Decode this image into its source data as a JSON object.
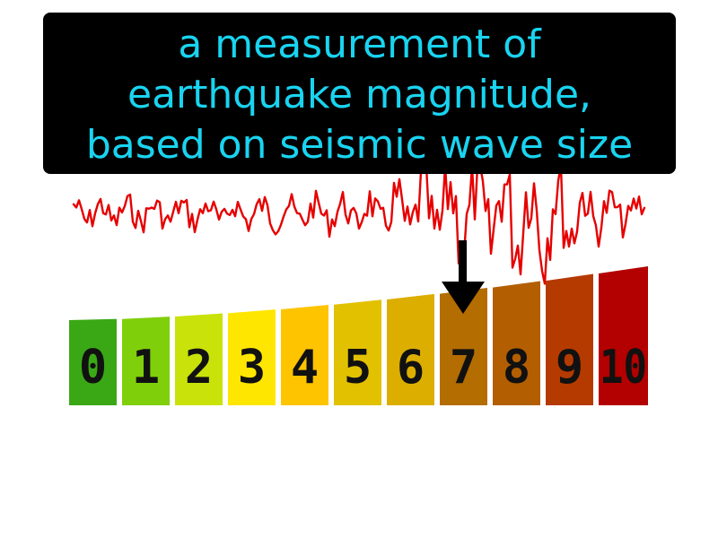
{
  "definition": {
    "lines": [
      "a measurement of",
      "earthquake magnitude,",
      "based on seismic wave size"
    ]
  },
  "colors": {
    "caption_text": "#19d4f0",
    "caption_bg": "#000000",
    "waveform": "#e60000",
    "arrow": "#000000"
  },
  "scale": {
    "labels": [
      "0",
      "1",
      "2",
      "3",
      "4",
      "5",
      "6",
      "7",
      "8",
      "9",
      "10"
    ],
    "colors": [
      "#3aa815",
      "#7fcf0a",
      "#c9e20a",
      "#ffe600",
      "#ffc400",
      "#e2c100",
      "#dcae00",
      "#b36d00",
      "#b35e00",
      "#b53a00",
      "#b30000"
    ],
    "highlighted_value": 7
  },
  "icons": {
    "arrow": "down-arrow-icon",
    "wave": "seismogram-waveform"
  }
}
